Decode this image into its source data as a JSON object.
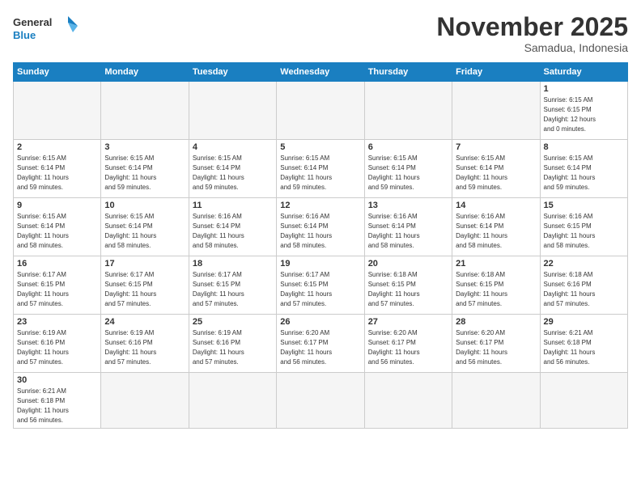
{
  "logo": {
    "general": "General",
    "blue": "Blue"
  },
  "title": "November 2025",
  "location": "Samadua, Indonesia",
  "weekdays": [
    "Sunday",
    "Monday",
    "Tuesday",
    "Wednesday",
    "Thursday",
    "Friday",
    "Saturday"
  ],
  "weeks": [
    [
      {
        "day": "",
        "info": ""
      },
      {
        "day": "",
        "info": ""
      },
      {
        "day": "",
        "info": ""
      },
      {
        "day": "",
        "info": ""
      },
      {
        "day": "",
        "info": ""
      },
      {
        "day": "",
        "info": ""
      },
      {
        "day": "1",
        "info": "Sunrise: 6:15 AM\nSunset: 6:15 PM\nDaylight: 12 hours\nand 0 minutes."
      }
    ],
    [
      {
        "day": "2",
        "info": "Sunrise: 6:15 AM\nSunset: 6:14 PM\nDaylight: 11 hours\nand 59 minutes."
      },
      {
        "day": "3",
        "info": "Sunrise: 6:15 AM\nSunset: 6:14 PM\nDaylight: 11 hours\nand 59 minutes."
      },
      {
        "day": "4",
        "info": "Sunrise: 6:15 AM\nSunset: 6:14 PM\nDaylight: 11 hours\nand 59 minutes."
      },
      {
        "day": "5",
        "info": "Sunrise: 6:15 AM\nSunset: 6:14 PM\nDaylight: 11 hours\nand 59 minutes."
      },
      {
        "day": "6",
        "info": "Sunrise: 6:15 AM\nSunset: 6:14 PM\nDaylight: 11 hours\nand 59 minutes."
      },
      {
        "day": "7",
        "info": "Sunrise: 6:15 AM\nSunset: 6:14 PM\nDaylight: 11 hours\nand 59 minutes."
      },
      {
        "day": "8",
        "info": "Sunrise: 6:15 AM\nSunset: 6:14 PM\nDaylight: 11 hours\nand 59 minutes."
      }
    ],
    [
      {
        "day": "9",
        "info": "Sunrise: 6:15 AM\nSunset: 6:14 PM\nDaylight: 11 hours\nand 58 minutes."
      },
      {
        "day": "10",
        "info": "Sunrise: 6:15 AM\nSunset: 6:14 PM\nDaylight: 11 hours\nand 58 minutes."
      },
      {
        "day": "11",
        "info": "Sunrise: 6:16 AM\nSunset: 6:14 PM\nDaylight: 11 hours\nand 58 minutes."
      },
      {
        "day": "12",
        "info": "Sunrise: 6:16 AM\nSunset: 6:14 PM\nDaylight: 11 hours\nand 58 minutes."
      },
      {
        "day": "13",
        "info": "Sunrise: 6:16 AM\nSunset: 6:14 PM\nDaylight: 11 hours\nand 58 minutes."
      },
      {
        "day": "14",
        "info": "Sunrise: 6:16 AM\nSunset: 6:14 PM\nDaylight: 11 hours\nand 58 minutes."
      },
      {
        "day": "15",
        "info": "Sunrise: 6:16 AM\nSunset: 6:15 PM\nDaylight: 11 hours\nand 58 minutes."
      }
    ],
    [
      {
        "day": "16",
        "info": "Sunrise: 6:17 AM\nSunset: 6:15 PM\nDaylight: 11 hours\nand 57 minutes."
      },
      {
        "day": "17",
        "info": "Sunrise: 6:17 AM\nSunset: 6:15 PM\nDaylight: 11 hours\nand 57 minutes."
      },
      {
        "day": "18",
        "info": "Sunrise: 6:17 AM\nSunset: 6:15 PM\nDaylight: 11 hours\nand 57 minutes."
      },
      {
        "day": "19",
        "info": "Sunrise: 6:17 AM\nSunset: 6:15 PM\nDaylight: 11 hours\nand 57 minutes."
      },
      {
        "day": "20",
        "info": "Sunrise: 6:18 AM\nSunset: 6:15 PM\nDaylight: 11 hours\nand 57 minutes."
      },
      {
        "day": "21",
        "info": "Sunrise: 6:18 AM\nSunset: 6:15 PM\nDaylight: 11 hours\nand 57 minutes."
      },
      {
        "day": "22",
        "info": "Sunrise: 6:18 AM\nSunset: 6:16 PM\nDaylight: 11 hours\nand 57 minutes."
      }
    ],
    [
      {
        "day": "23",
        "info": "Sunrise: 6:19 AM\nSunset: 6:16 PM\nDaylight: 11 hours\nand 57 minutes."
      },
      {
        "day": "24",
        "info": "Sunrise: 6:19 AM\nSunset: 6:16 PM\nDaylight: 11 hours\nand 57 minutes."
      },
      {
        "day": "25",
        "info": "Sunrise: 6:19 AM\nSunset: 6:16 PM\nDaylight: 11 hours\nand 57 minutes."
      },
      {
        "day": "26",
        "info": "Sunrise: 6:20 AM\nSunset: 6:17 PM\nDaylight: 11 hours\nand 56 minutes."
      },
      {
        "day": "27",
        "info": "Sunrise: 6:20 AM\nSunset: 6:17 PM\nDaylight: 11 hours\nand 56 minutes."
      },
      {
        "day": "28",
        "info": "Sunrise: 6:20 AM\nSunset: 6:17 PM\nDaylight: 11 hours\nand 56 minutes."
      },
      {
        "day": "29",
        "info": "Sunrise: 6:21 AM\nSunset: 6:18 PM\nDaylight: 11 hours\nand 56 minutes."
      }
    ],
    [
      {
        "day": "30",
        "info": "Sunrise: 6:21 AM\nSunset: 6:18 PM\nDaylight: 11 hours\nand 56 minutes."
      },
      {
        "day": "",
        "info": ""
      },
      {
        "day": "",
        "info": ""
      },
      {
        "day": "",
        "info": ""
      },
      {
        "day": "",
        "info": ""
      },
      {
        "day": "",
        "info": ""
      },
      {
        "day": "",
        "info": ""
      }
    ]
  ]
}
